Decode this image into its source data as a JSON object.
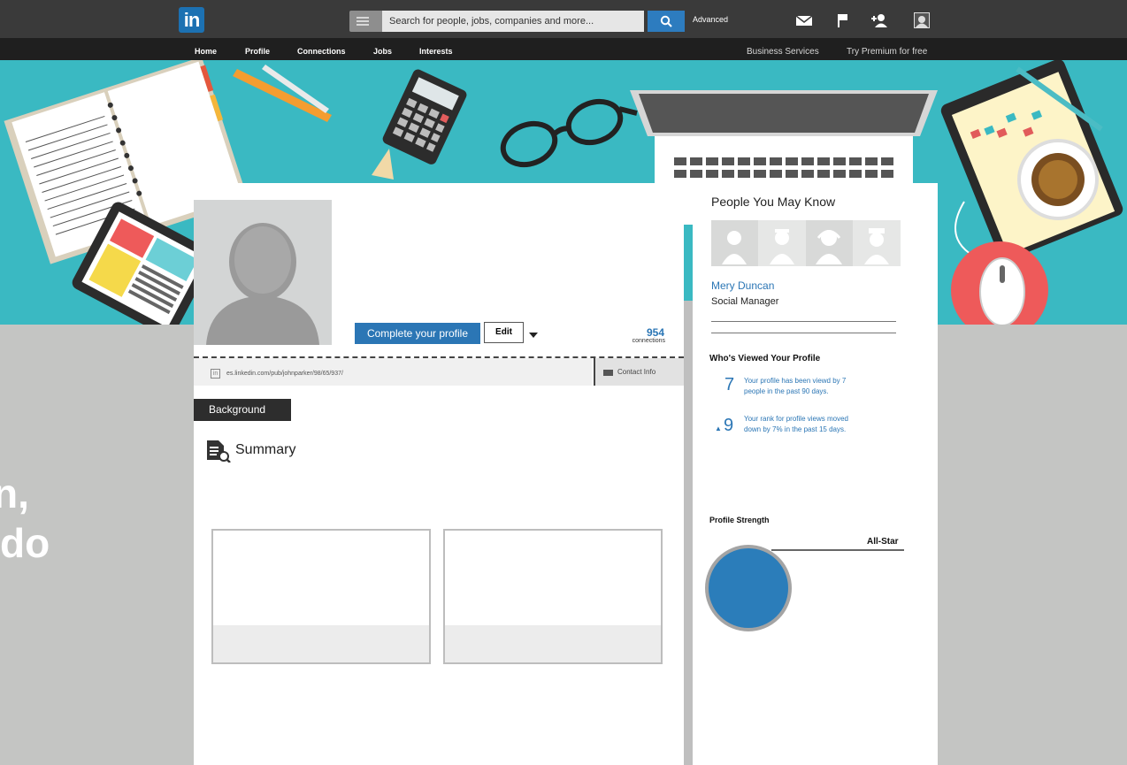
{
  "header": {
    "logo_text": "in",
    "search_placeholder": "Search for people, jobs, companies and more...",
    "advanced_label": "Advanced",
    "icons": [
      "mail-icon",
      "flag-icon",
      "add-connection-icon",
      "account-icon"
    ]
  },
  "nav": {
    "items": [
      "Home",
      "Profile",
      "Connections",
      "Jobs",
      "Interests"
    ],
    "right_items": [
      "Business Services",
      "Try Premium for free"
    ]
  },
  "profile": {
    "complete_label": "Complete your profile",
    "edit_label": "Edit",
    "connections_count": "954",
    "connections_label": "connections",
    "url": "es.linkedin.com/pub/johnparker/98/65/937/",
    "contact_label": "Contact Info",
    "background_tab": "Background",
    "summary_title": "Summary"
  },
  "side": {
    "pymk_title": "People You May Know",
    "person_name": "Mery Duncan",
    "person_role": "Social Manager",
    "viewed_title": "Who's Viewed Your Profile",
    "views_count": "7",
    "views_text_1": "Your profile has been viewd by 7",
    "views_text_2": "people in the past 90 days.",
    "rank_count": "9",
    "rank_text_1": "Your rank for profile views moved",
    "rank_text_2": "down by 7% in the past 15 days.",
    "strength_title": "Profile Strength",
    "strength_level": "All-Star"
  },
  "overlay": {
    "line1": "n,",
    "line2": "do"
  },
  "colors": {
    "linkedin_blue": "#1c71b2",
    "accent_blue": "#2b76b5",
    "banner_teal": "#3ab9c2",
    "topbar": "#3a3a3a"
  }
}
